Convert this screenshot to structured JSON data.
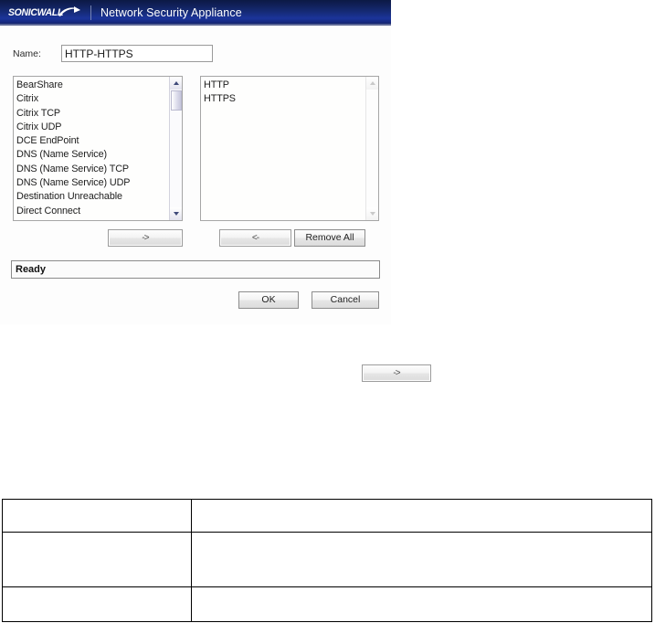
{
  "dialog": {
    "titlebar": {
      "logo_text": "SONICWALL",
      "logo_icon": "sonicwall-swoosh-icon",
      "product_title": "Network Security Appliance"
    },
    "name_field": {
      "label": "Name:",
      "value": "HTTP-HTTPS",
      "placeholder": ""
    },
    "available_list": {
      "items": [
        "BearShare",
        "Citrix",
        "Citrix TCP",
        "Citrix UDP",
        "DCE EndPoint",
        "DNS (Name Service)",
        "DNS (Name Service) TCP",
        "DNS (Name Service) UDP",
        "Destination Unreachable",
        "Direct Connect"
      ]
    },
    "selected_list": {
      "items": [
        "HTTP",
        "HTTPS"
      ]
    },
    "transfer_buttons": {
      "add_label": "->",
      "remove_label": "<-",
      "remove_all_label": "Remove All"
    },
    "status": {
      "text": "Ready"
    },
    "actions": {
      "ok_label": "OK",
      "cancel_label": "Cancel"
    }
  },
  "callout": {
    "standalone_button_label": "->"
  },
  "bottom_table": {
    "rows": [
      {
        "label": "",
        "value": ""
      },
      {
        "label": "",
        "value": ""
      },
      {
        "label": "",
        "value": ""
      }
    ]
  },
  "colors": {
    "titlebar_dark": "#0b1945",
    "titlebar_bright": "#1b349a",
    "dialog_background": "#fdfdfd",
    "border": "#8d8d8d",
    "table_border": "#000000"
  }
}
